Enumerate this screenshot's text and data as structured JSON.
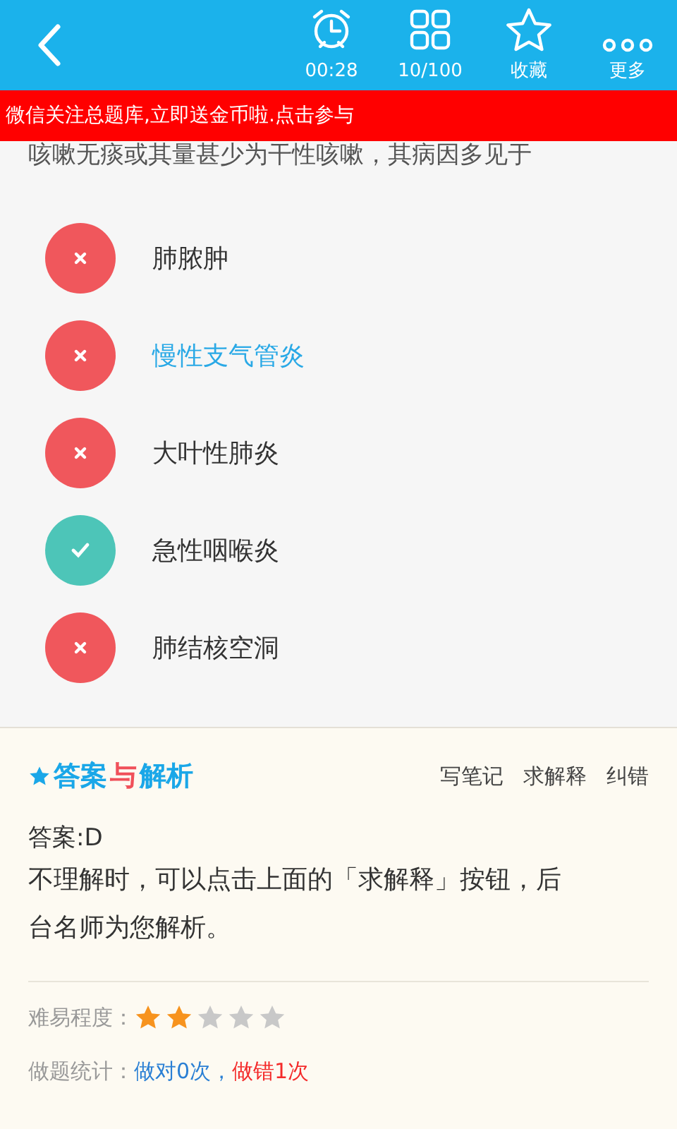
{
  "toolbar": {
    "items": [
      {
        "kind": "timer",
        "label": "00:28"
      },
      {
        "kind": "grid",
        "label": "10/100"
      },
      {
        "kind": "star",
        "label": "收藏"
      },
      {
        "kind": "more",
        "label": "更多"
      }
    ]
  },
  "banner": "微信关注总题库,立即送金币啦.点击参与",
  "question": "咳嗽无痰或其量甚少为干性咳嗽，其病因多见于",
  "options": [
    {
      "text": "肺脓肿",
      "correct": false,
      "selected": false
    },
    {
      "text": "慢性支气管炎",
      "correct": false,
      "selected": true
    },
    {
      "text": "大叶性肺炎",
      "correct": false,
      "selected": false
    },
    {
      "text": "急性咽喉炎",
      "correct": true,
      "selected": false
    },
    {
      "text": "肺结核空洞",
      "correct": false,
      "selected": false
    }
  ],
  "analysis": {
    "logo": [
      {
        "text": "答案",
        "color": "#1aa7e8"
      },
      {
        "text": "与",
        "color": "#f0505a"
      },
      {
        "text": "解析",
        "color": "#1aa7e8"
      }
    ],
    "actions": [
      "写笔记",
      "求解释",
      "纠错"
    ],
    "answer": "答案:D",
    "explanation": "不理解时，可以点击上面的「求解释」按钮，后台名师为您解析。",
    "difficulty_label": "难易程度：",
    "stars": 2,
    "stats_label": "做题统计：",
    "stats": [
      {
        "text": "做对0次，",
        "color": "#2a7fd4"
      },
      {
        "text": "做错1次",
        "color": "#f42a2a"
      }
    ]
  }
}
